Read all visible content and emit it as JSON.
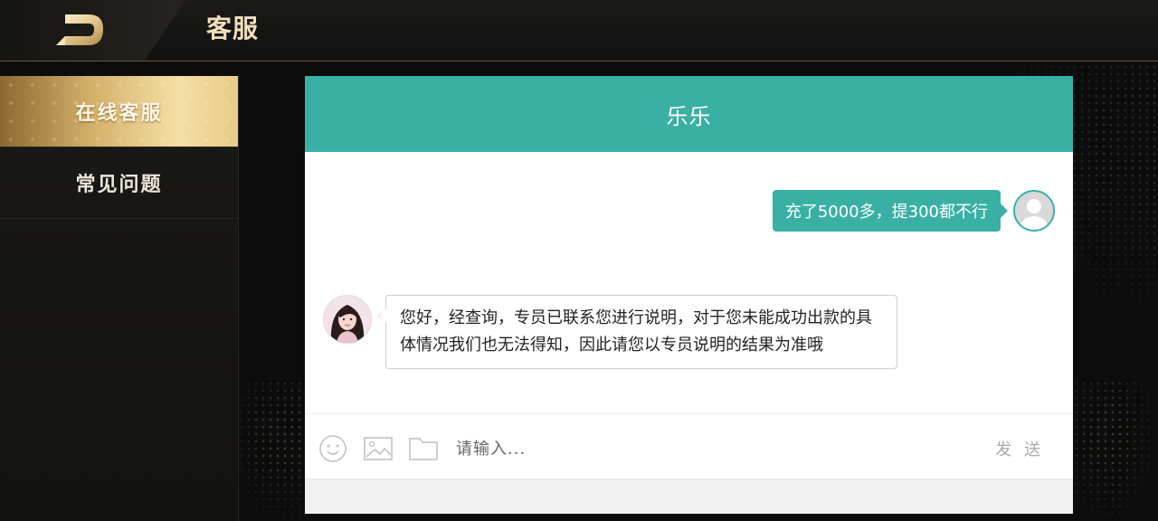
{
  "header": {
    "title": "客服",
    "back_icon": "back-logo-icon"
  },
  "sidebar": {
    "items": [
      {
        "label": "在线客服",
        "active": true
      },
      {
        "label": "常见问题",
        "active": false
      }
    ]
  },
  "chat": {
    "agent_name": "乐乐",
    "messages": [
      {
        "from": "user",
        "text": "充了5000多，提300都不行"
      },
      {
        "from": "agent",
        "text": "您好，经查询，专员已联系您进行说明，对于您未能成功出款的具体情况我们也无法得知，因此请您以专员说明的结果为准哦"
      }
    ],
    "input": {
      "value": "",
      "placeholder": "请输入..."
    },
    "send_label": "发 送",
    "tools": [
      "emoji-icon",
      "image-icon",
      "folder-icon"
    ]
  },
  "colors": {
    "accent": "#3ab0a5",
    "gold": "#d6b36c",
    "background": "#0c0c0c"
  }
}
